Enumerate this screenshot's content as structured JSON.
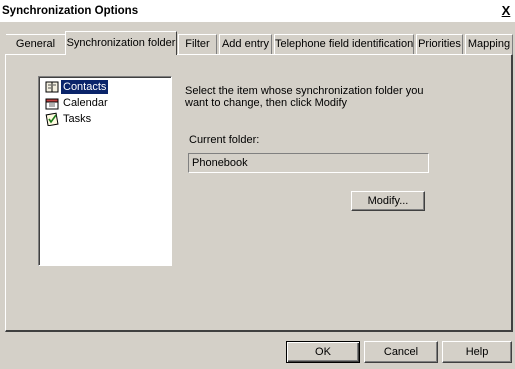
{
  "window": {
    "title": "Synchronization Options",
    "close_label": "X"
  },
  "tabs": [
    "General",
    "Synchronization folder",
    "Filter",
    "Add entry",
    "Telephone field identification",
    "Priorities",
    "Mapping"
  ],
  "active_tab": "Synchronization folder",
  "folders": {
    "items": [
      {
        "label": "Contacts",
        "icon": "contacts-icon",
        "selected": true
      },
      {
        "label": "Calendar",
        "icon": "calendar-icon",
        "selected": false
      },
      {
        "label": "Tasks",
        "icon": "tasks-icon",
        "selected": false
      }
    ]
  },
  "instructions": {
    "line1": "Select the item whose synchronization folder you",
    "line2": "want to change, then click Modify"
  },
  "current_folder": {
    "label": "Current folder:",
    "value": "Phonebook"
  },
  "modify_button": "Modify...",
  "footer": {
    "ok": "OK",
    "cancel": "Cancel",
    "help": "Help"
  },
  "colors": {
    "face": "#d4d0c8",
    "selection": "#0a246a"
  }
}
